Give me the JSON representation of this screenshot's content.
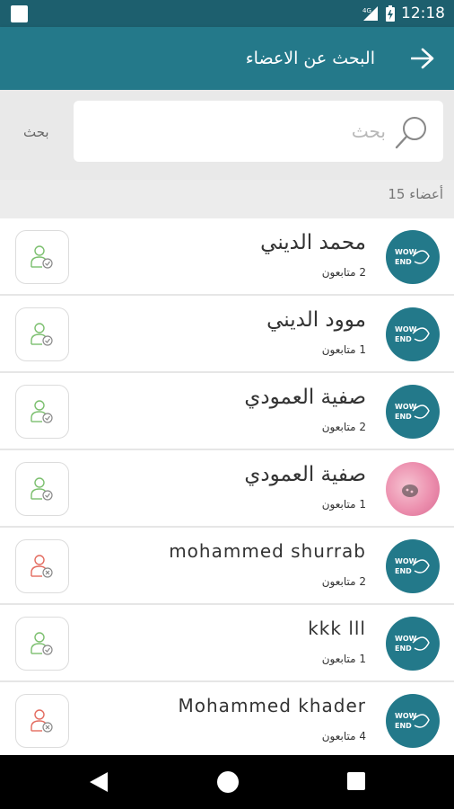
{
  "status_bar": {
    "time": "12:18",
    "network": "4G"
  },
  "app_bar": {
    "title": "البحث عن الاعضاء"
  },
  "search": {
    "placeholder": "بحث",
    "value": "",
    "side_label": "بحث"
  },
  "members_count": "أعضاء 15",
  "colors": {
    "primary": "#24798a",
    "status": "#1d5f6e",
    "follow_green": "#7bbf6e",
    "unfollow_red": "#e36b5f"
  },
  "members": [
    {
      "name": "محمد  الديني",
      "followers": "2 متابعون",
      "avatar": "logo",
      "follow_state": "following"
    },
    {
      "name": "موود  الديني",
      "followers": "1 متابعون",
      "avatar": "logo",
      "follow_state": "following"
    },
    {
      "name": "صفية العمودي",
      "followers": "2 متابعون",
      "avatar": "logo",
      "follow_state": "following"
    },
    {
      "name": "صفية العمودي",
      "followers": "1 متابعون",
      "avatar": "photo",
      "follow_state": "following"
    },
    {
      "name": "mohammed shurrab",
      "followers": "2 متابعون",
      "avatar": "logo",
      "follow_state": "not-following"
    },
    {
      "name": "kkk lll",
      "followers": "1 متابعون",
      "avatar": "logo",
      "follow_state": "following"
    },
    {
      "name": "Mohammed khader",
      "followers": "4 متابعون",
      "avatar": "logo",
      "follow_state": "not-following"
    }
  ]
}
